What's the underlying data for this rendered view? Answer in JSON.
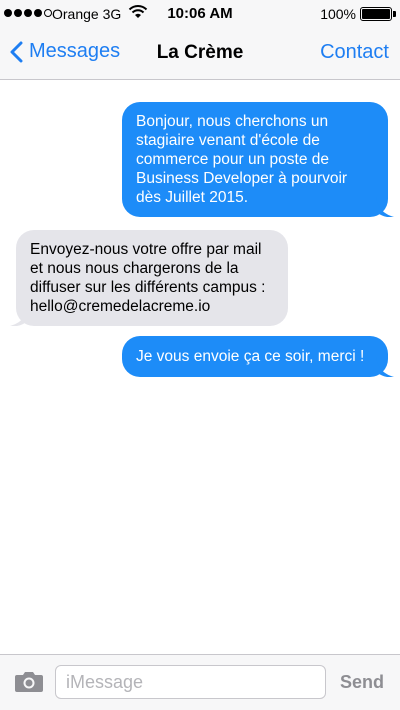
{
  "status_bar": {
    "carrier": "Orange 3G",
    "time": "10:06 AM",
    "battery": "100%",
    "battery_level": 1.0,
    "signal_bars_filled": 4,
    "signal_bars_total": 5
  },
  "nav": {
    "back_label": "Messages",
    "title": "La Crème",
    "contact_label": "Contact"
  },
  "messages": [
    {
      "direction": "outgoing",
      "text": "Bonjour, nous cherchons un stagiaire venant d'école de commerce pour un poste de Business Developer à pourvoir dès Juillet 2015."
    },
    {
      "direction": "incoming",
      "text": "Envoyez-nous votre offre par mail et nous nous chargerons de la diffuser sur les différents campus : hello@cremedelacreme.io"
    },
    {
      "direction": "outgoing",
      "text": "Je vous envoie ça ce soir, merci !"
    }
  ],
  "input": {
    "placeholder": "iMessage",
    "value": "",
    "send_label": "Send"
  },
  "colors": {
    "accent": "#1e7ef2",
    "outgoing_bubble": "#1d8cf8",
    "incoming_bubble": "#e5e5ea",
    "send_disabled": "#8e8e93"
  },
  "icons": [
    "signal-dots-icon",
    "wifi-icon",
    "battery-icon",
    "chevron-left-icon",
    "camera-icon"
  ]
}
